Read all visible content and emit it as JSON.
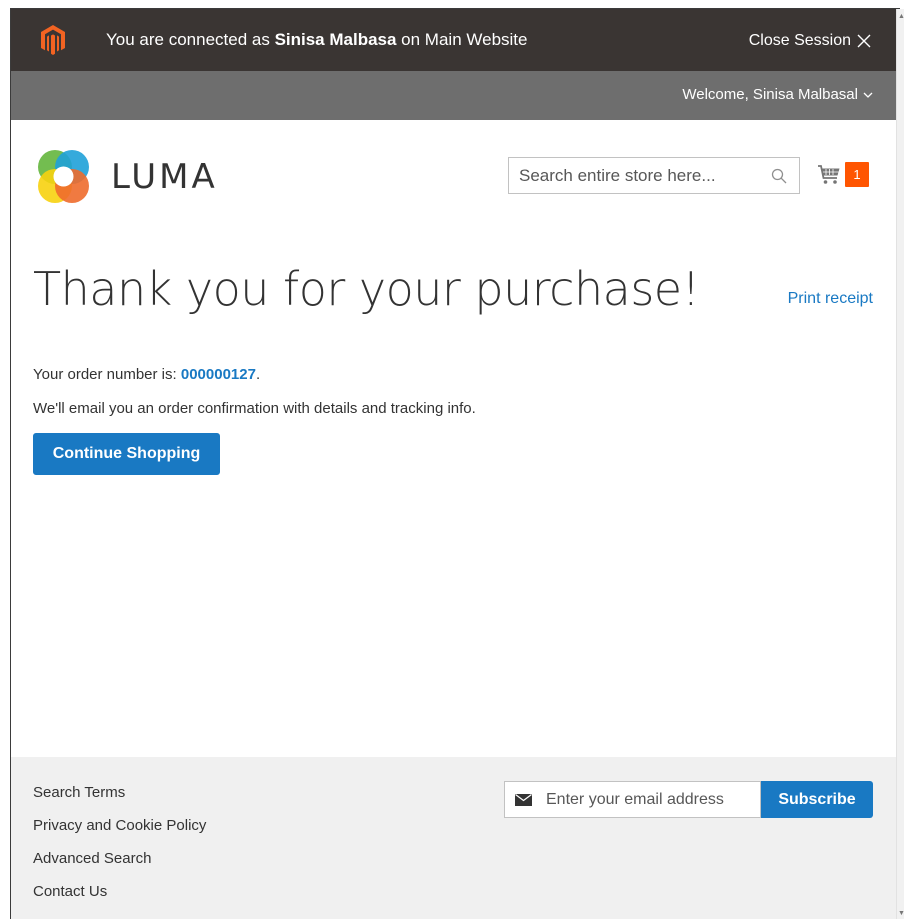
{
  "session_bar": {
    "prefix": "You are connected as ",
    "user": "Sinisa Malbasa",
    "suffix": " on Main Website",
    "close_label": "Close Session"
  },
  "welcome_bar": {
    "welcome": "Welcome, Sinisa Malbasal"
  },
  "header": {
    "logo_text": "LUMA",
    "search_placeholder": "Search entire store here...",
    "cart_count": "1"
  },
  "main": {
    "title": "Thank you for your purchase!",
    "print_receipt": "Print receipt",
    "order_prefix": "Your order number is: ",
    "order_number": "000000127",
    "order_suffix": ".",
    "email_note": "We'll email you an order confirmation with details and tracking info.",
    "continue_label": "Continue Shopping"
  },
  "footer": {
    "links": [
      "Search Terms",
      "Privacy and Cookie Policy",
      "Advanced Search",
      "Contact Us"
    ],
    "email_placeholder": "Enter your email address",
    "subscribe_label": "Subscribe"
  },
  "colors": {
    "session_bar": "#3a3533",
    "welcome_bar": "#6e6e6e",
    "accent_blue": "#1979c3",
    "cart_badge": "#ff5501",
    "footer_bg": "#f0f0f0"
  }
}
